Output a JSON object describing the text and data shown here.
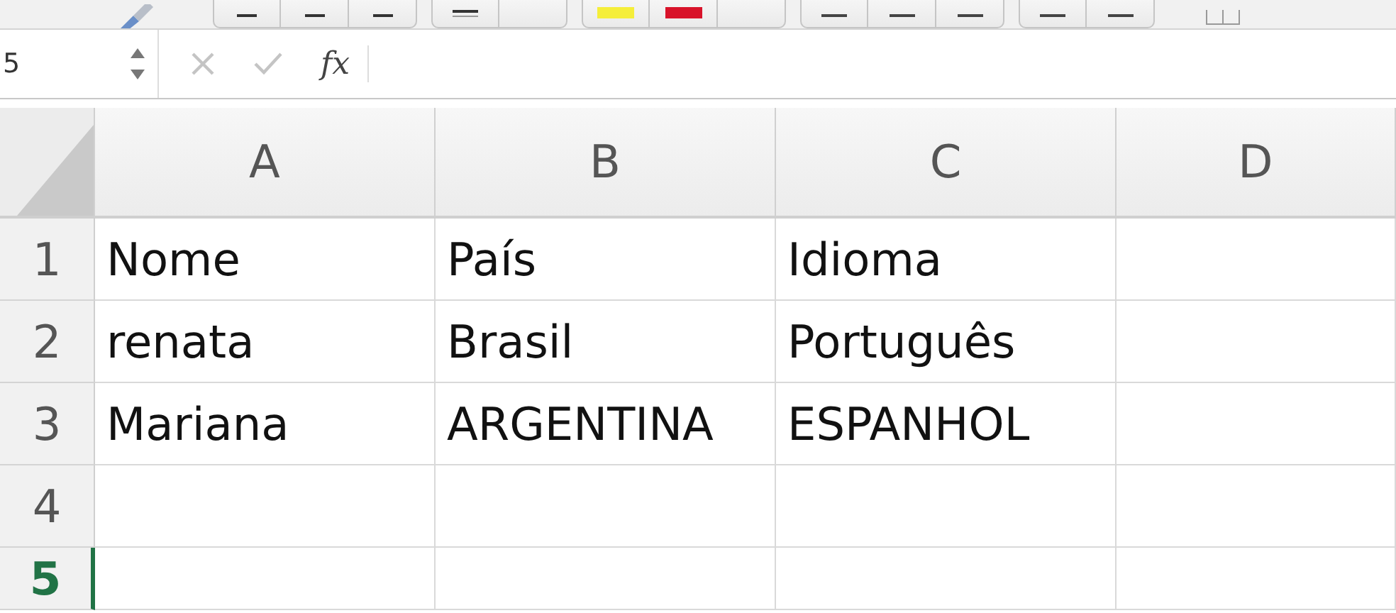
{
  "toolbar": [
    {
      "kind": "brush"
    },
    {
      "kind": "group",
      "buttons": [
        {
          "kind": "bold"
        },
        {
          "kind": "italic"
        },
        {
          "kind": "underline"
        }
      ]
    },
    {
      "kind": "group",
      "buttons": [
        {
          "kind": "border"
        },
        {
          "kind": "caret"
        }
      ]
    },
    {
      "kind": "group",
      "buttons": [
        {
          "kind": "swatch",
          "color": "#f5ee3a"
        },
        {
          "kind": "swatch",
          "color": "#d8132a"
        },
        {
          "kind": "caret"
        }
      ]
    },
    {
      "kind": "group",
      "buttons": [
        {
          "kind": "align"
        },
        {
          "kind": "align"
        },
        {
          "kind": "align"
        }
      ]
    },
    {
      "kind": "group",
      "buttons": [
        {
          "kind": "indent"
        },
        {
          "kind": "indent"
        }
      ]
    },
    {
      "kind": "merge"
    }
  ],
  "formula_bar": {
    "name_box": "5",
    "function_label": "fx"
  },
  "columns": [
    {
      "label": "A",
      "selected": false
    },
    {
      "label": "B",
      "selected": false
    },
    {
      "label": "C",
      "selected": false
    },
    {
      "label": "D",
      "selected": false
    }
  ],
  "rows": [
    {
      "header": "1",
      "selected": false,
      "cells": [
        "Nome",
        "País",
        "Idioma",
        ""
      ]
    },
    {
      "header": "2",
      "selected": false,
      "cells": [
        "renata",
        "Brasil",
        "Português",
        ""
      ]
    },
    {
      "header": "3",
      "selected": false,
      "cells": [
        "Mariana",
        "ARGENTINA",
        "ESPANHOL",
        ""
      ]
    },
    {
      "header": "4",
      "selected": false,
      "cells": [
        "",
        "",
        "",
        ""
      ]
    },
    {
      "header": "5",
      "selected": true,
      "cells": [
        "",
        "",
        "",
        ""
      ]
    }
  ]
}
